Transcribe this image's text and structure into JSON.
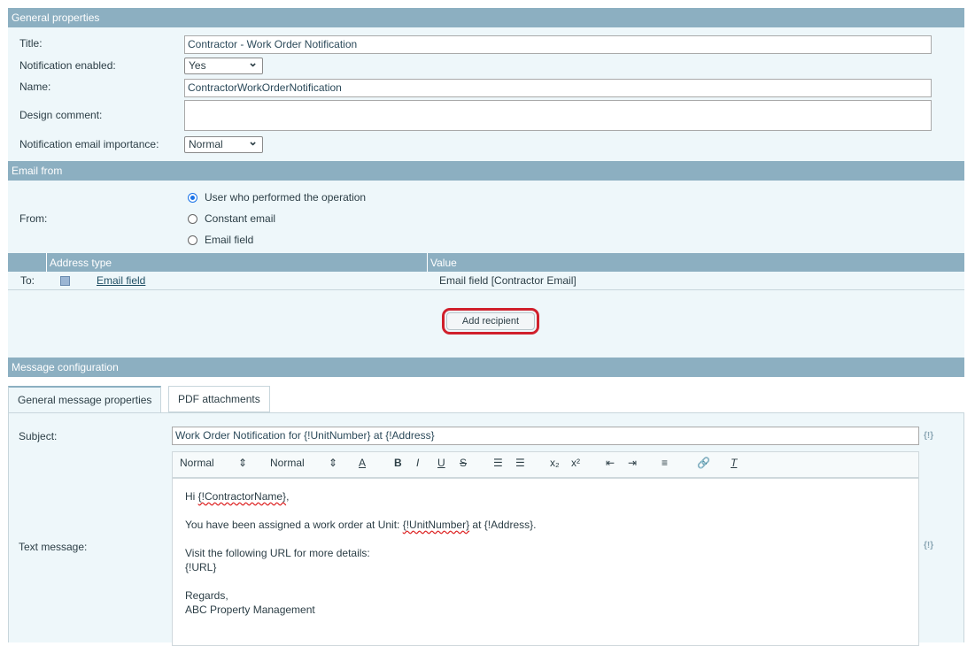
{
  "general": {
    "header": "General properties",
    "title_label": "Title:",
    "title_value": "Contractor - Work Order Notification",
    "enabled_label": "Notification enabled:",
    "enabled_value": "Yes",
    "name_label": "Name:",
    "name_value": "ContractorWorkOrderNotification",
    "comment_label": "Design comment:",
    "comment_value": "",
    "importance_label": "Notification email importance:",
    "importance_value": "Normal"
  },
  "email_from": {
    "header": "Email from",
    "from_label": "From:",
    "options": [
      {
        "label": "User who performed the operation",
        "selected": true
      },
      {
        "label": "Constant email",
        "selected": false
      },
      {
        "label": "Email field",
        "selected": false
      }
    ]
  },
  "recipients": {
    "columns": [
      "Address type",
      "Value"
    ],
    "rows": [
      {
        "prefix": "To:",
        "icon": "email-field-icon",
        "type": "Email field",
        "value": "Email field [Contractor Email]"
      }
    ],
    "add_button": "Add recipient"
  },
  "message": {
    "header": "Message configuration",
    "tabs": [
      {
        "label": "General message properties",
        "active": true
      },
      {
        "label": "PDF attachments",
        "active": false
      }
    ],
    "subject_label": "Subject:",
    "subject_value": "Work Order Notification for {!UnitNumber} at {!Address}",
    "macro_icon": "{!}",
    "text_label": "Text message:",
    "toolbar": {
      "format1": "Normal",
      "format2": "Normal",
      "buttons": [
        "font-color",
        "bold",
        "italic",
        "underline",
        "strikethrough",
        "ordered-list",
        "bullet-list",
        "subscript",
        "superscript",
        "outdent",
        "indent",
        "align",
        "link",
        "clear-format"
      ]
    },
    "body": {
      "greeting_pre": "Hi ",
      "greeting_var": "{!ContractorName}",
      "greeting_post": ",",
      "line2_pre": "You have been assigned a work order at Unit: ",
      "line2_var": "{!UnitNumber}",
      "line2_post": " at {!Address}.",
      "line3": "Visit the following URL for more details:",
      "line4": "{!URL}",
      "line5": "Regards,",
      "line6": "ABC Property Management"
    }
  }
}
